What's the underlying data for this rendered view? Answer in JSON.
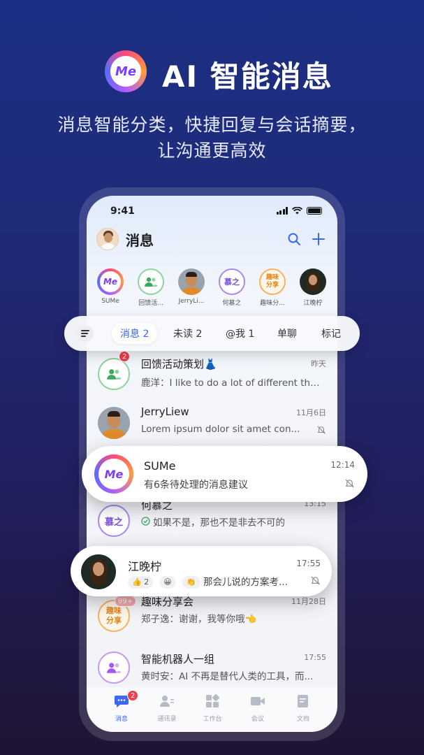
{
  "hero": {
    "title": "AI 智能消息",
    "subtitle_line1": "消息智能分类，快捷回复与会话摘要，",
    "subtitle_line2": "让沟通更高效",
    "logo_text": "Me"
  },
  "status_bar": {
    "time": "9:41"
  },
  "header": {
    "title": "消息"
  },
  "stories": [
    {
      "label": "SUMe",
      "avatar_text": "Me"
    },
    {
      "label": "回馈活...",
      "avatar_text": ""
    },
    {
      "label": "JerryLi...",
      "avatar_text": ""
    },
    {
      "label": "何慕之",
      "avatar_text": "慕之"
    },
    {
      "label": "趣味分...",
      "avatar_text": "趣味分享"
    },
    {
      "label": "江晚柠",
      "avatar_text": ""
    }
  ],
  "filters": {
    "tabs": [
      "消息 2",
      "未读 2",
      "@我 1",
      "单聊",
      "标记"
    ],
    "active": "消息 2"
  },
  "conversations": [
    {
      "title": "回馈活动策划👗",
      "time": "昨天",
      "preview": "鹿洋：I like to do a lot of different thi...",
      "badge": "2"
    },
    {
      "title": "JerryLiew",
      "time": "11月6日",
      "preview": "Lorem ipsum dolor sit amet con..."
    },
    {
      "title": "SUMe",
      "time": "12:14",
      "preview": "有6条待处理的消息建议",
      "avatar_text": "Me"
    },
    {
      "title": "何慕之",
      "time": "13:15",
      "preview": "如果不是，那也不是非去不可的",
      "avatar_text": "慕之"
    },
    {
      "title": "江晚柠",
      "time": "17:55",
      "preview": "那会儿说的方案考...",
      "reactions": [
        "👍 2",
        "😀",
        "👏"
      ]
    },
    {
      "title": "趣味分享会",
      "time": "11月28日",
      "preview": "郑子逸：谢谢，我等你哦👈",
      "badge": "99+",
      "avatar_text": "趣味分享"
    },
    {
      "title": "智能机器人一组",
      "time": "17:55",
      "preview": "黄时安：AI 不再是替代人类的工具，而..."
    }
  ],
  "tabbar": {
    "items": [
      "消息",
      "通讯录",
      "工作台",
      "会议",
      "文档"
    ],
    "badge": "2",
    "active": "消息"
  },
  "colors": {
    "accent": "#3a67f5",
    "badge": "#f23c4a",
    "green": "#3aaa5e",
    "purple": "#7a4fe0",
    "orange": "#f09a2c"
  }
}
